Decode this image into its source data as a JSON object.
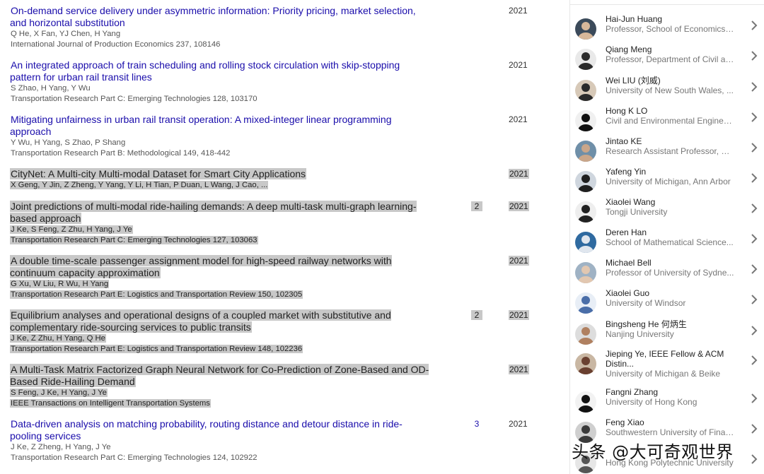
{
  "publications": [
    {
      "title": "On-demand service delivery under asymmetric information: Priority pricing, market selection, and horizontal substitution",
      "authors": "Q He, X Fan, YJ Chen, H Yang",
      "venue": "International Journal of Production Economics 237, 108146",
      "cited_by": "",
      "year": "2021",
      "selected": false
    },
    {
      "title": "An integrated approach of train scheduling and rolling stock circulation with skip-stopping pattern for urban rail transit lines",
      "authors": "S Zhao, H Yang, Y Wu",
      "venue": "Transportation Research Part C: Emerging Technologies 128, 103170",
      "cited_by": "",
      "year": "2021",
      "selected": false
    },
    {
      "title": "Mitigating unfairness in urban rail transit operation: A mixed-integer linear programming approach",
      "authors": "Y Wu, H Yang, S Zhao, P Shang",
      "venue": "Transportation Research Part B: Methodological 149, 418-442",
      "cited_by": "",
      "year": "2021",
      "selected": false
    },
    {
      "title": "CityNet: A Multi-city Multi-modal Dataset for Smart City Applications",
      "authors": "X Geng, Y Jin, Z Zheng, Y Yang, Y Li, H Tian, P Duan, L Wang, J Cao, ...",
      "venue": "",
      "cited_by": "",
      "year": "2021",
      "selected": true
    },
    {
      "title": "Joint predictions of multi-modal ride-hailing demands: A deep multi-task multi-graph learning-based approach",
      "authors": "J Ke, S Feng, Z Zhu, H Yang, J Ye",
      "venue": "Transportation Research Part C: Emerging Technologies 127, 103063",
      "cited_by": "2",
      "year": "2021",
      "selected": true
    },
    {
      "title": "A double time-scale passenger assignment model for high-speed railway networks with continuum capacity approximation",
      "authors": "G Xu, W Liu, R Wu, H Yang",
      "venue": "Transportation Research Part E: Logistics and Transportation Review 150, 102305",
      "cited_by": "",
      "year": "2021",
      "selected": true
    },
    {
      "title": "Equilibrium analyses and operational designs of a coupled market with substitutive and complementary ride-sourcing services to public transits",
      "authors": "J Ke, Z Zhu, H Yang, Q He",
      "venue": "Transportation Research Part E: Logistics and Transportation Review 148, 102236",
      "cited_by": "2",
      "year": "2021",
      "selected": true
    },
    {
      "title": "A Multi-Task Matrix Factorized Graph Neural Network for Co-Prediction of Zone-Based and OD-Based Ride-Hailing Demand",
      "authors": "S Feng, J Ke, H Yang, J Ye",
      "venue": "IEEE Transactions on Intelligent Transportation Systems",
      "cited_by": "",
      "year": "2021",
      "selected": true
    },
    {
      "title": "Data-driven analysis on matching probability, routing distance and detour distance in ride-pooling services",
      "authors": "J Ke, Z Zheng, H Yang, J Ye",
      "venue": "Transportation Research Part C: Emerging Technologies 124, 102922",
      "cited_by": "3",
      "year": "2021",
      "selected": false
    }
  ],
  "coauthors": [
    {
      "name": "Hai-Jun Huang",
      "affiliation": "Professor, School of Economics ..."
    },
    {
      "name": "Qiang Meng",
      "affiliation": "Professor, Department of Civil an..."
    },
    {
      "name": "Wei LIU (刘威)",
      "affiliation": "University of New South Wales, ..."
    },
    {
      "name": "Hong K LO",
      "affiliation": "Civil and Environmental Enginee..."
    },
    {
      "name": "Jintao KE",
      "affiliation": "Research Assistant Professor, H..."
    },
    {
      "name": "Yafeng Yin",
      "affiliation": "University of Michigan, Ann Arbor"
    },
    {
      "name": "Xiaolei Wang",
      "affiliation": "Tongji University"
    },
    {
      "name": "Deren Han",
      "affiliation": "School of Mathematical Science..."
    },
    {
      "name": "Michael Bell",
      "affiliation": "Professor of University of Sydne..."
    },
    {
      "name": "Xiaolei Guo",
      "affiliation": "University of Windsor"
    },
    {
      "name": "Bingsheng He 何炳生",
      "affiliation": "Nanjing University"
    },
    {
      "name": "Jieping Ye, IEEE Fellow & ACM Distin...",
      "affiliation": "University of Michigan & Beike"
    },
    {
      "name": "Fangni Zhang",
      "affiliation": "University of Hong Kong"
    },
    {
      "name": "Feng Xiao",
      "affiliation": "Southwestern University of Finan..."
    },
    {
      "name": "",
      "affiliation": "Hong Kong Polytechnic University"
    }
  ],
  "icons": {
    "chevron": "chevron-right-icon",
    "avatar": "avatar"
  },
  "watermark": "头条 @大可奇观世界",
  "colors": {
    "link": "#1a0dab",
    "highlight": "#c8c8c8"
  }
}
